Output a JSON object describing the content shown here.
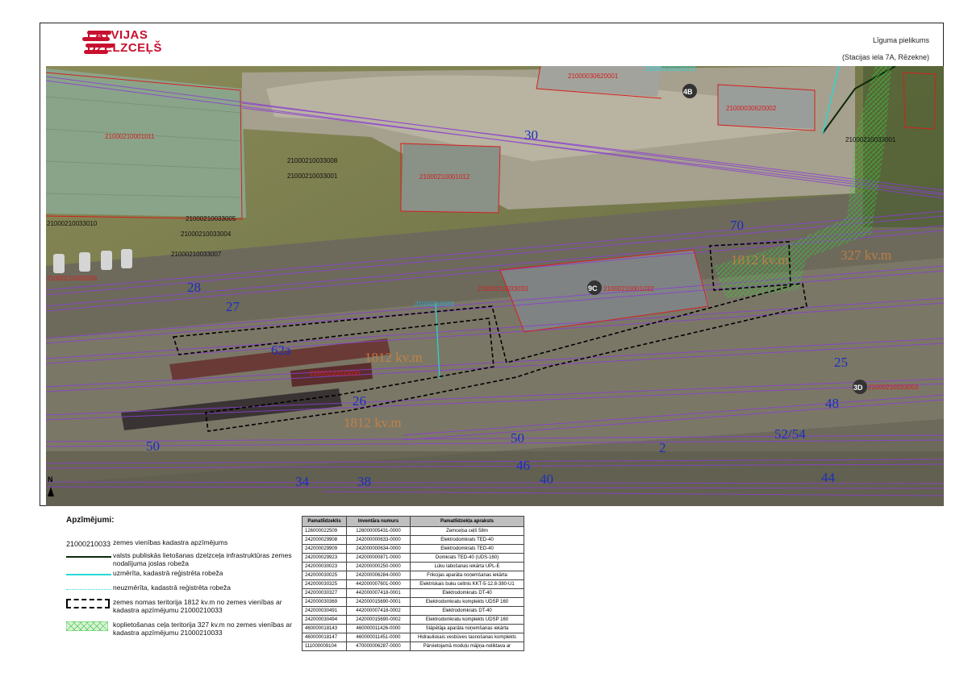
{
  "header": {
    "brand_line1": "LATVIJAS",
    "brand_line2": "DZELZCEĻŠ",
    "doc_title": "Līguma pielikums",
    "doc_subtitle": "(Stacijas iela 7A, Rēzekne)"
  },
  "colors": {
    "brand_red": "#c8102e",
    "track_purple": "#8a3fd1",
    "parcel_red": "#d42020",
    "track_number_blue": "#1a2fbf",
    "lease_area_black": "#000000",
    "crossing_green": "#3cc23c"
  },
  "map": {
    "parcel_labels": [
      "21000210001011",
      "21000210001012",
      "21000210033008",
      "21000210033001",
      "21000210033005",
      "21000210033004",
      "21000210033007",
      "21000210033010",
      "21000210033036",
      "21000030620001",
      "21000030620002",
      "21000030620020",
      "21000210033001",
      "21000210033033",
      "21000210001032",
      "21000210033",
      "21000210033030",
      "21000210033003"
    ],
    "track_numbers": [
      "30",
      "70",
      "28",
      "27",
      "62a",
      "25",
      "26",
      "48",
      "52/54",
      "50",
      "50",
      "2",
      "46",
      "34",
      "38",
      "40",
      "44"
    ],
    "building_markers": [
      "4B",
      "9C",
      "3D"
    ],
    "area_labels": [
      "1812 kv.m",
      "327 kv.m",
      "1812 kv.m",
      "1812 kv.m"
    ],
    "north_label": "N"
  },
  "legend": {
    "title": "Apzīmējumi:",
    "items": [
      {
        "symbol_text": "21000210033",
        "text": "zemes vienības kadastra apzīmējums"
      },
      {
        "symbol_text": "",
        "text": "valsts publiskās lietošanas dzelzceļa infrastruktūras zemes nodalījuma joslas robeža"
      },
      {
        "symbol_text": "",
        "text": "uzmērīta, kadastrā reģistrēta robeža"
      },
      {
        "symbol_text": "",
        "text": "neuzmērīta, kadastrā reģistrēta robeža"
      },
      {
        "symbol_text": "",
        "text": "zemes nomas teritorija 1812 kv.m no zemes vienības ar kadastra apzīmējumu 21000210033"
      },
      {
        "symbol_text": "",
        "text": "koplietošanas ceļa teritorija 327 kv.m no zemes vienības ar kadastra apzīmējumu 21000210033"
      }
    ]
  },
  "asset_table": {
    "headers": [
      "Pamatlīdzeklis",
      "Inventāra numurs",
      "Pamatlīdzekļa apraksts"
    ],
    "rows": [
      [
        "126000022509",
        "126000005431-0000",
        "Zemceļsa ceļš 58m"
      ],
      [
        "242000029908",
        "242000000633-0000",
        "Elektrodomkrats TED-40"
      ],
      [
        "242000029909",
        "242000000634-0000",
        "Elektrodomkrats TED-40"
      ],
      [
        "242000029923",
        "242000000871-0000",
        "Domkrats TED-40 (UDS-160)"
      ],
      [
        "242000030023",
        "242000000250-0000",
        "Lūku labošanas iekārta UPL-E"
      ],
      [
        "242000030025",
        "242000006284-0000",
        "Frikcijas aparāta noņemšanas iekārta"
      ],
      [
        "242000030325",
        "442000007601-0000",
        "Elektriskais buku celtnis KKT-5-12.8-380-U1"
      ],
      [
        "242000030327",
        "442000007418-0001",
        "Elektrodomkrats DT-40"
      ],
      [
        "242000030369",
        "242000015690-0001",
        "Elektrodomkratu komplekts UDSP 160"
      ],
      [
        "242000030491",
        "442000007418-0002",
        "Elektrodomkrats DT-40"
      ],
      [
        "242000030494",
        "242000015690-0002",
        "Elektrodomkratu komplekts UDSP 160"
      ],
      [
        "460000018143",
        "460000011426-0000",
        "Slāpētāja aparāta noņemšanas iekārta"
      ],
      [
        "460000018147",
        "460000011451-0000",
        "Hidrauliskais vesbūves tasnošanas komplekts"
      ],
      [
        "111000009104",
        "470000006287-0000",
        "Pārvietojamā moduļu mājiņa-noliktava ar"
      ]
    ]
  }
}
